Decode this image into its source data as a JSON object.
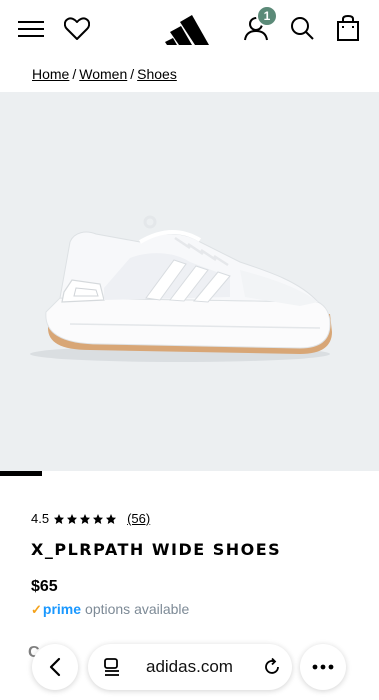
{
  "header": {
    "menu_icon": "hamburger-menu-icon",
    "wishlist_icon": "heart-icon",
    "logo": "adidas-logo",
    "account_icon": "user-icon",
    "account_badge": "1",
    "search_icon": "search-icon",
    "bag_icon": "shopping-bag-icon",
    "badge_color": "#5b8a78"
  },
  "breadcrumb": {
    "items": [
      "Home",
      "Women",
      "Shoes"
    ],
    "separator": "/"
  },
  "product": {
    "image_background": "#eceff1",
    "carousel_current": 1,
    "rating": "4.5",
    "stars": 5,
    "review_count": "(56)",
    "title": "X_PLRPATH WIDE SHOES",
    "price": "$65",
    "prime_label": "prime",
    "prime_text": "options available",
    "next_section_partial": "Co"
  },
  "browser": {
    "url": "adidas.com",
    "back_icon": "chevron-left-icon",
    "tabs_icon": "tabs-icon",
    "reload_icon": "reload-icon",
    "more_icon": "more-dots-icon"
  }
}
